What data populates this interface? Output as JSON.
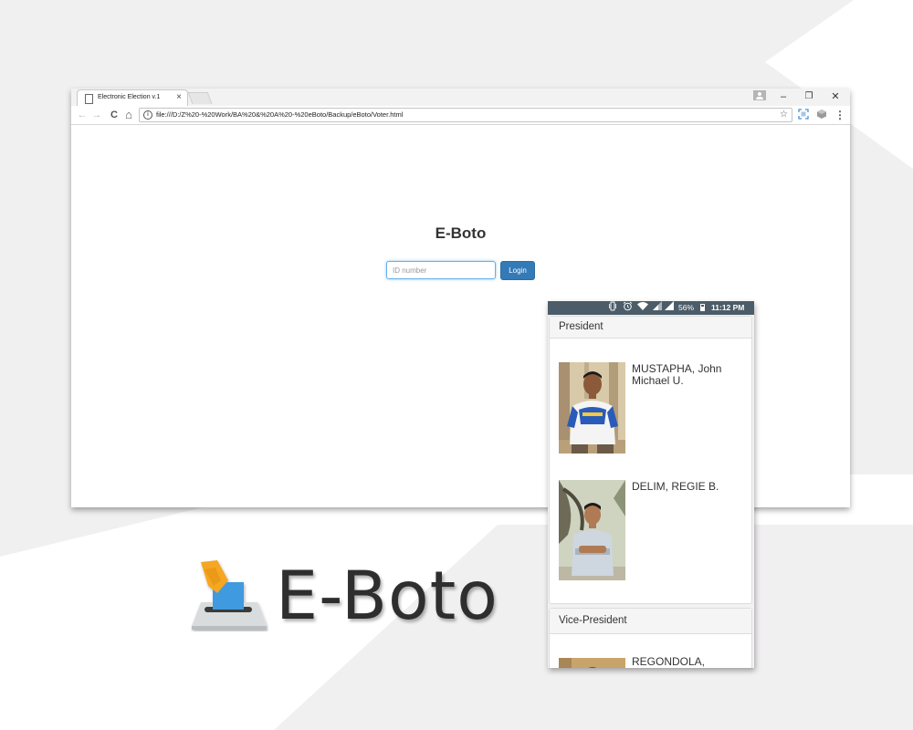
{
  "browser": {
    "tab_title": "Electronic Election v.1",
    "tab_close": "×",
    "url": "file:///D:/Z%20-%20Work/BA%20&%20A%20-%20eBoto/Backup/eBoto/Voter.html",
    "controls": {
      "minimize": "–",
      "restore": "❐",
      "close": "✕"
    },
    "nav": {
      "back": "←",
      "forward": "→",
      "reload": "C",
      "home": "⌂",
      "menu": "⋮",
      "star": "☆"
    }
  },
  "login": {
    "title": "E-Boto",
    "input_placeholder": "ID number",
    "button_label": "Login"
  },
  "phone": {
    "status": {
      "battery": "56%",
      "time": "11:12 PM"
    },
    "sections": [
      {
        "title": "President",
        "candidates": [
          {
            "name": "MUSTAPHA, John Michael U."
          },
          {
            "name": "DELIM, REGIE B."
          }
        ]
      },
      {
        "title": "Vice-President",
        "candidates": [
          {
            "name": "REGONDOLA,"
          }
        ]
      }
    ]
  },
  "logo": {
    "text": "E-Boto"
  },
  "colors": {
    "accent": "#337ab7",
    "statusbar": "#4c5d69",
    "background_gray": "#f1f0f1",
    "logo_text": "#2e2e2e",
    "ballot_blue": "#3f9ae0",
    "hand_orange": "#f5a623"
  }
}
